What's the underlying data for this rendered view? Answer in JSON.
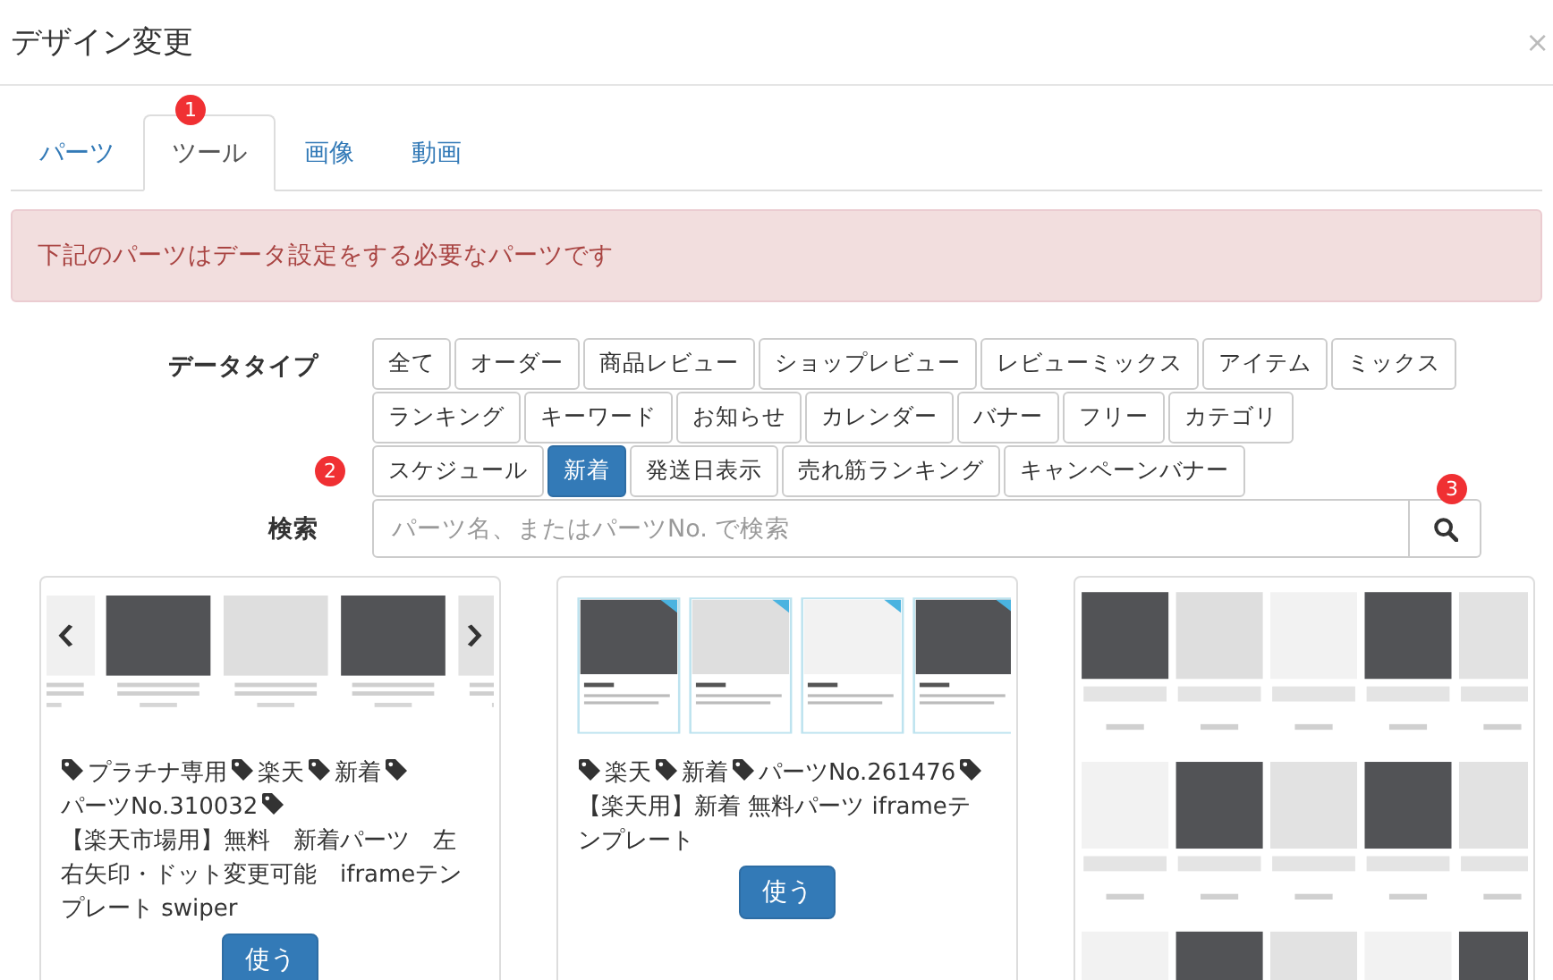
{
  "dialog": {
    "title": "デザイン変更",
    "close": "×"
  },
  "tabs": [
    {
      "label": "パーツ",
      "selected": false
    },
    {
      "label": "ツール",
      "selected": true,
      "badge": "1"
    },
    {
      "label": "画像",
      "selected": false
    },
    {
      "label": "動画",
      "selected": false
    }
  ],
  "alert": "下記のパーツはデータ設定をする必要なパーツです",
  "data_type": {
    "label": "データタイプ",
    "badge": "2",
    "options": [
      {
        "label": "全て",
        "selected": false
      },
      {
        "label": "オーダー",
        "selected": false
      },
      {
        "label": "商品レビュー",
        "selected": false
      },
      {
        "label": "ショップレビュー",
        "selected": false
      },
      {
        "label": "レビューミックス",
        "selected": false
      },
      {
        "label": "アイテム",
        "selected": false
      },
      {
        "label": "ミックス",
        "selected": false
      },
      {
        "label": "ランキング",
        "selected": false
      },
      {
        "label": "キーワード",
        "selected": false
      },
      {
        "label": "お知らせ",
        "selected": false
      },
      {
        "label": "カレンダー",
        "selected": false
      },
      {
        "label": "バナー",
        "selected": false
      },
      {
        "label": "フリー",
        "selected": false
      },
      {
        "label": "カテゴリ",
        "selected": false
      },
      {
        "label": "スケジュール",
        "selected": false
      },
      {
        "label": "新着",
        "selected": true
      },
      {
        "label": "発送日表示",
        "selected": false
      },
      {
        "label": "売れ筋ランキング",
        "selected": false
      },
      {
        "label": "キャンペーンバナー",
        "selected": false
      }
    ]
  },
  "search": {
    "label": "検索",
    "placeholder": "パーツ名、またはパーツNo. で検索",
    "badge": "3"
  },
  "cards": [
    {
      "tags": [
        "プラチナ専用",
        "楽天",
        "新着",
        "パーツNo.310032",
        "【楽天市場用】無料　新着パーツ　左右矢印・ドット変更可能　iframeテンプレート swiper"
      ],
      "button": "使う"
    },
    {
      "tags": [
        "楽天",
        "新着",
        "パーツNo.261476",
        "【楽天用】新着 無料パーツ iframeテンプレート"
      ],
      "button": "使う"
    },
    {
      "kind": "picture"
    }
  ]
}
